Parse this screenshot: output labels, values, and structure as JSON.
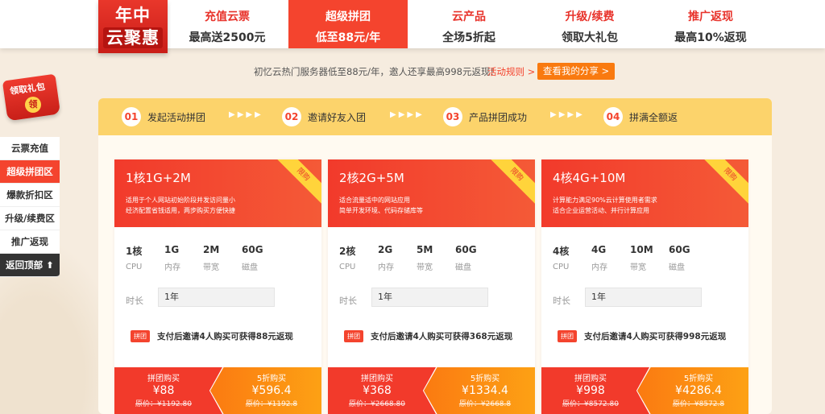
{
  "logo": {
    "line1": "年中",
    "line2": "云聚惠"
  },
  "nav": [
    {
      "title": "充值云票",
      "sub": "最高送2500元"
    },
    {
      "title": "超级拼团",
      "sub": "低至88元/年"
    },
    {
      "title": "云产品",
      "sub": "全场5折起"
    },
    {
      "title": "升级/续费",
      "sub": "领取大礼包"
    },
    {
      "title": "推广返现",
      "sub": "最高10%返现"
    }
  ],
  "notice": {
    "text": "初忆云热门服务器低至88元/年，邀人还享最高998元返现!",
    "rules_link": "活动规则 >",
    "share_button": "查看我的分享 >"
  },
  "gift": {
    "label": "领取礼包",
    "seal": "领"
  },
  "sidebar": {
    "items": [
      "云票充值",
      "超级拼团区",
      "爆款折扣区",
      "升级/续费区",
      "推广返现"
    ],
    "back_top": "返回顶部 ⬆"
  },
  "steps": [
    {
      "num": "01",
      "label": "发起活动拼团"
    },
    {
      "num": "02",
      "label": "邀请好友入团"
    },
    {
      "num": "03",
      "label": "产品拼团成功"
    },
    {
      "num": "04",
      "label": "拼满全额返"
    }
  ],
  "step_arrow": "▶▶▶▶",
  "spec_labels": [
    "CPU",
    "内存",
    "带宽",
    "磁盘"
  ],
  "common": {
    "ribbon": "限购",
    "duration_label": "时长",
    "group_tag": "拼团",
    "group_buy": "拼团购买",
    "discount_buy": "5折购买"
  },
  "cards": [
    {
      "title": "1核1G+2M",
      "desc1": "适用于个人网站初始阶段并发访问量小",
      "desc2": "经济配置省钱适用，两步购买方便快捷",
      "specs": [
        "1核",
        "1G",
        "2M",
        "60G"
      ],
      "duration": "1年",
      "promo": "支付后邀请4人购买可获得88元返现",
      "group_price": "¥88",
      "group_orig": "原价：¥1192.80",
      "disc_price": "¥596.4",
      "disc_orig": "原价：¥1192.8"
    },
    {
      "title": "2核2G+5M",
      "desc1": "适合流量适中的网站应用",
      "desc2": "简单开发环境、代码存储库等",
      "specs": [
        "2核",
        "2G",
        "5M",
        "60G"
      ],
      "duration": "1年",
      "promo": "支付后邀请4人购买可获得368元返现",
      "group_price": "¥368",
      "group_orig": "原价：¥2668.80",
      "disc_price": "¥1334.4",
      "disc_orig": "原价：¥2668.8"
    },
    {
      "title": "4核4G+10M",
      "desc1": "计算能力满足90%云计算使用者需求",
      "desc2": "适合企业运营活动、并行计算应用",
      "specs": [
        "4核",
        "4G",
        "10M",
        "60G"
      ],
      "duration": "1年",
      "promo": "支付后邀请4人购买可获得998元返现",
      "group_price": "¥998",
      "group_orig": "原价：¥8572.80",
      "disc_price": "¥4286.4",
      "disc_orig": "原价：¥8572.8"
    }
  ]
}
